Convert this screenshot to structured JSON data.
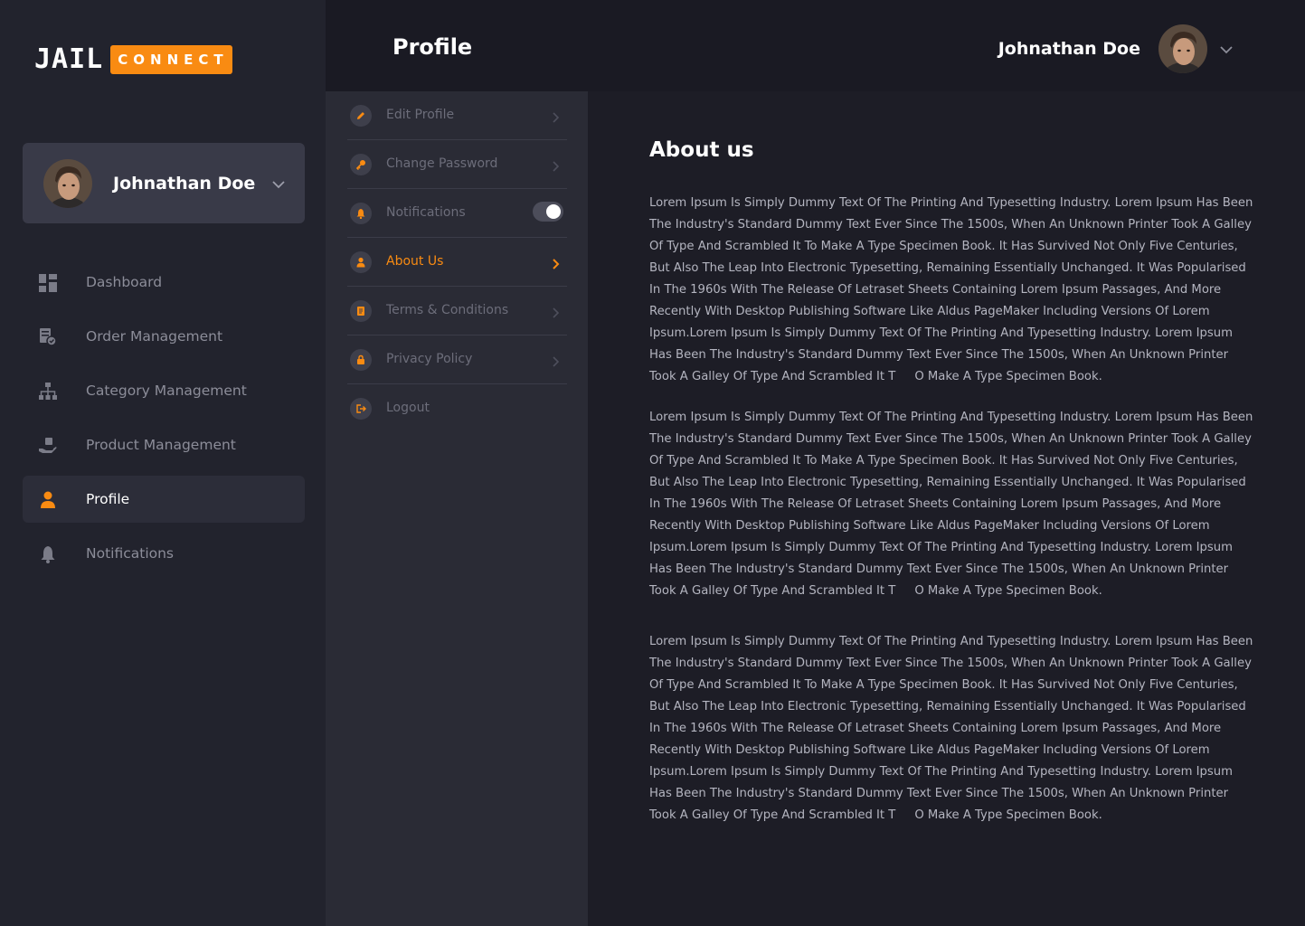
{
  "brand": {
    "logo_left": "JAIL",
    "logo_right": "CONNECT",
    "accent": "#f98b12"
  },
  "sidebar": {
    "user": {
      "name": "Johnathan Doe"
    },
    "items": [
      {
        "label": "Dashboard",
        "icon": "dashboard-icon"
      },
      {
        "label": "Order Management",
        "icon": "order-icon"
      },
      {
        "label": "Category Management",
        "icon": "category-icon"
      },
      {
        "label": "Product Management",
        "icon": "product-icon"
      },
      {
        "label": "Profile",
        "icon": "user-icon",
        "active": true
      },
      {
        "label": "Notifications",
        "icon": "bell-icon"
      }
    ]
  },
  "header": {
    "title": "Profile",
    "user_name": "Johnathan Doe"
  },
  "settings_menu": {
    "items": [
      {
        "label": "Edit Profile",
        "icon": "pencil-icon"
      },
      {
        "label": "Change Password",
        "icon": "key-icon"
      },
      {
        "label": "Notifications",
        "icon": "bell-icon",
        "toggle": true
      },
      {
        "label": "About Us",
        "icon": "user-icon",
        "active": true
      },
      {
        "label": "Terms & Conditions",
        "icon": "document-icon"
      },
      {
        "label": "Privacy Policy",
        "icon": "lock-icon"
      },
      {
        "label": "Logout",
        "icon": "logout-icon"
      }
    ],
    "notifications_enabled": true
  },
  "content": {
    "title": "About us",
    "paragraphs": [
      "Lorem Ipsum Is Simply Dummy Text Of The Printing And Typesetting Industry. Lorem Ipsum Has Been The Industry's Standard Dummy Text Ever Since The 1500s, When An Unknown Printer Took A Galley Of Type And Scrambled It To Make A Type Specimen Book. It Has Survived Not Only Five Centuries, But Also The Leap Into Electronic Typesetting, Remaining Essentially Unchanged. It Was Popularised In The 1960s With The Release Of Letraset Sheets Containing Lorem Ipsum Passages, And More Recently With Desktop Publishing Software Like Aldus PageMaker Including Versions Of Lorem Ipsum.Lorem Ipsum Is Simply Dummy Text Of The Printing And Typesetting Industry. Lorem Ipsum Has Been The Industry's Standard Dummy Text Ever Since The 1500s, When An Unknown Printer Took A Galley Of Type And Scrambled It T     O Make A Type Specimen Book.",
      "Lorem Ipsum Is Simply Dummy Text Of The Printing And Typesetting Industry. Lorem Ipsum Has Been The Industry's Standard Dummy Text Ever Since The 1500s, When An Unknown Printer Took A Galley Of Type And Scrambled It To Make A Type Specimen Book. It Has Survived Not Only Five Centuries, But Also The Leap Into Electronic Typesetting, Remaining Essentially Unchanged. It Was Popularised In The 1960s With The Release Of Letraset Sheets Containing Lorem Ipsum Passages, And More Recently With Desktop Publishing Software Like Aldus PageMaker Including Versions Of Lorem Ipsum.Lorem Ipsum Is Simply Dummy Text Of The Printing And Typesetting Industry. Lorem Ipsum Has Been The Industry's Standard Dummy Text Ever Since The 1500s, When An Unknown Printer Took A Galley Of Type And Scrambled It T     O Make A Type Specimen Book.",
      "Lorem Ipsum Is Simply Dummy Text Of The Printing And Typesetting Industry. Lorem Ipsum Has Been The Industry's Standard Dummy Text Ever Since The 1500s, When An Unknown Printer Took A Galley Of Type And Scrambled It To Make A Type Specimen Book. It Has Survived Not Only Five Centuries, But Also The Leap Into Electronic Typesetting, Remaining Essentially Unchanged. It Was Popularised In The 1960s With The Release Of Letraset Sheets Containing Lorem Ipsum Passages, And More Recently With Desktop Publishing Software Like Aldus PageMaker Including Versions Of Lorem Ipsum.Lorem Ipsum Is Simply Dummy Text Of The Printing And Typesetting Industry. Lorem Ipsum Has Been The Industry's Standard Dummy Text Ever Since The 1500s, When An Unknown Printer Took A Galley Of Type And Scrambled It T     O Make A Type Specimen Book."
    ]
  }
}
